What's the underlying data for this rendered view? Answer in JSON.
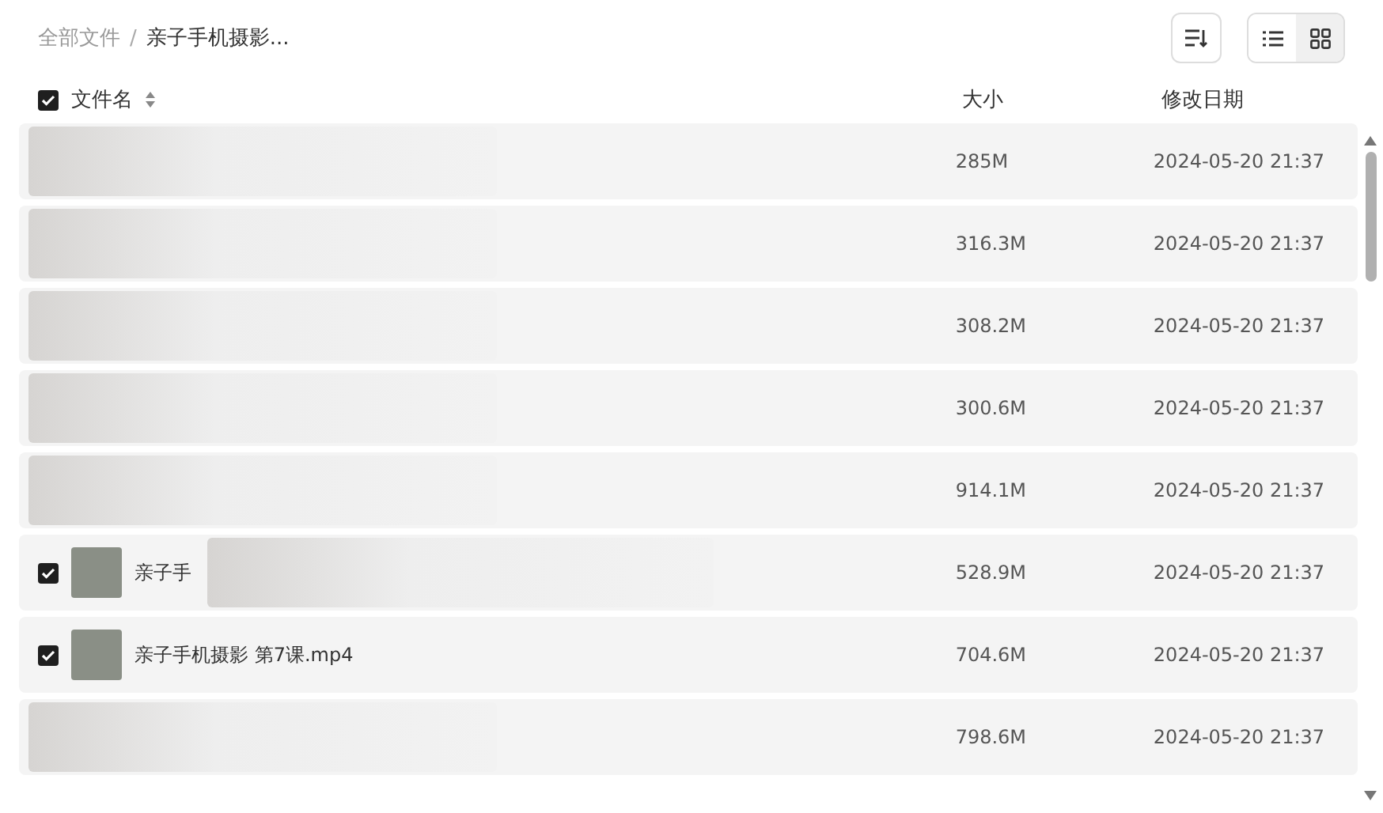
{
  "breadcrumb_separator": "/",
  "breadcrumb": [
    {
      "label": "全部文件",
      "current": false
    },
    {
      "label": "亲子手机摄影...",
      "current": true
    }
  ],
  "view_toggle": [
    {
      "kind": "list",
      "selected": false
    },
    {
      "kind": "grid",
      "selected": true
    }
  ],
  "table": {
    "select_all_checked": true,
    "columns": [
      "文件名",
      "大小",
      "修改日期"
    ],
    "rows": [
      {
        "redacted": true,
        "size": "285M",
        "date": "2024-05-20 21:37"
      },
      {
        "redacted": true,
        "size": "316.3M",
        "date": "2024-05-20 21:37"
      },
      {
        "redacted": true,
        "size": "308.2M",
        "date": "2024-05-20 21:37"
      },
      {
        "redacted": true,
        "size": "300.6M",
        "date": "2024-05-20 21:37"
      },
      {
        "redacted": true,
        "size": "914.1M",
        "date": "2024-05-20 21:37"
      },
      {
        "redacted": true,
        "checked": true,
        "name": "亲子手",
        "size": "528.9M",
        "date": "2024-05-20 21:37"
      },
      {
        "redacted": false,
        "checked": true,
        "name": "亲子手机摄影 第7课.mp4",
        "size": "704.6M",
        "date": "2024-05-20 21:37"
      },
      {
        "redacted": true,
        "size": "798.6M",
        "date": "2024-05-20 21:37"
      }
    ]
  }
}
